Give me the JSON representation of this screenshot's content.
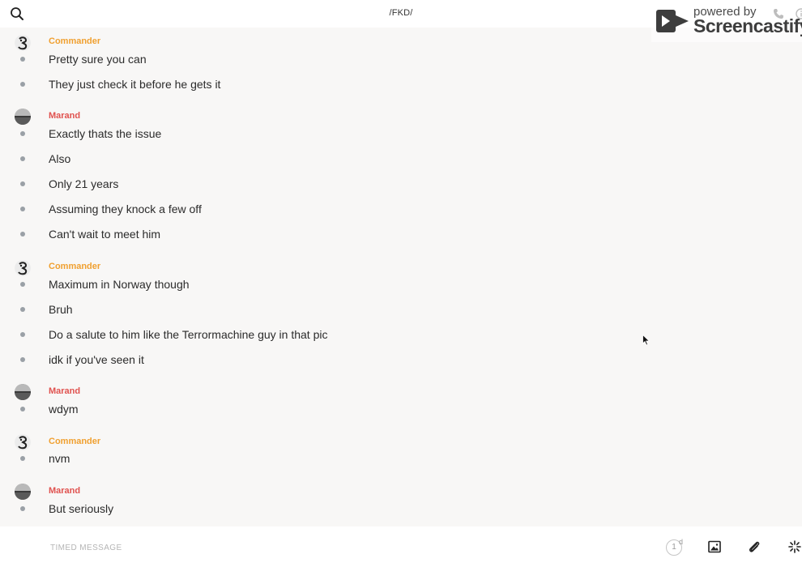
{
  "header": {
    "channel": "/FKD/"
  },
  "watermark": {
    "powered_by": "powered by",
    "brand": "Screencastify"
  },
  "authors": {
    "commander": "Commander",
    "marand": "Marand"
  },
  "messages": [
    "Pretty sure you can",
    "They just check it before he gets it",
    "Exactly thats the issue",
    "Also",
    "Only 21 years",
    "Assuming they knock a few off",
    "Can't wait to meet him",
    "Maximum in Norway though",
    "Bruh",
    "Do a salute to him like the Terrormachine guy in that pic",
    "idk if you've seen it",
    "wdym",
    "nvm",
    "But seriously"
  ],
  "composer": {
    "placeholder": "TIMED MESSAGE",
    "timer_value": "1",
    "timer_unit": "d"
  },
  "icons": {
    "search": "search-icon",
    "phone": "phone-icon",
    "info": "info-icon",
    "image": "image-icon",
    "attach": "paperclip-icon",
    "options": "sparkle-icon"
  },
  "colors": {
    "commander": "#f0a030",
    "marand": "#e0524f",
    "background": "#f8f7f6"
  }
}
